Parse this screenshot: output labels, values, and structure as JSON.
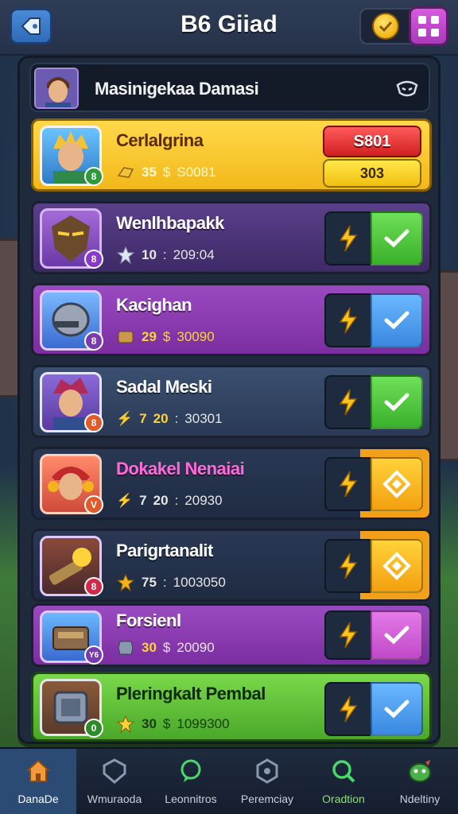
{
  "header": {
    "title": "B6 Giiad"
  },
  "panel": {
    "title": "Masinigekaa Damasi"
  },
  "rows": [
    {
      "name": "Cerlalgrina",
      "stat_a": "35",
      "stat_sep": "$",
      "stat_b": "S0081",
      "price_primary": "S801",
      "price_secondary": "303",
      "badge": "8",
      "theme": "featured"
    },
    {
      "name": "Wenlhbapakk",
      "stat_a": "10",
      "stat_sep": ":",
      "stat_b": "209:04",
      "badge": "8",
      "theme": "purple",
      "action": "green"
    },
    {
      "name": "Kacighan",
      "stat_a": "29",
      "stat_sep": "$",
      "stat_b": "30090",
      "badge": "8",
      "theme": "violet",
      "action": "blue"
    },
    {
      "name": "Sadal Meski",
      "stat_a": "20",
      "stat_prefix": "7",
      "stat_sep": ":",
      "stat_b": "30301",
      "badge": "8",
      "theme": "slate",
      "action": "green"
    },
    {
      "name": "Dokakel Nenaiai",
      "stat_a": "20",
      "stat_prefix": "7",
      "stat_sep": ":",
      "stat_b": "20930",
      "badge": "V",
      "theme": "dark",
      "action": "gold"
    },
    {
      "name": "Parigrtanalit",
      "stat_a": "75",
      "stat_sep": ":",
      "stat_b": "1003050",
      "badge": "8",
      "theme": "dark",
      "action": "gold"
    },
    {
      "name": "Forsienl",
      "stat_a": "30",
      "stat_sep": "$",
      "stat_b": "20090",
      "badge": "Y6",
      "theme": "violet",
      "action": "pink"
    },
    {
      "name": "Pleringkalt Pembal",
      "stat_a": "30",
      "stat_sep": "$",
      "stat_b": "1099300",
      "badge": "0",
      "theme": "green",
      "action": "blue"
    }
  ],
  "nav": [
    {
      "label": "DanaDe",
      "icon": "home-icon"
    },
    {
      "label": "Wmuraoda",
      "icon": "shield-icon"
    },
    {
      "label": "Leonnitros",
      "icon": "chat-icon"
    },
    {
      "label": "Peremciay",
      "icon": "badge-icon"
    },
    {
      "label": "Oradtion",
      "icon": "search-icon"
    },
    {
      "label": "Ndeltiny",
      "icon": "monster-icon"
    }
  ],
  "colors": {
    "accent_gold": "#f4c21a",
    "accent_purple": "#7b3fa8",
    "accent_green": "#3ab02a",
    "accent_blue": "#3a88e0"
  }
}
